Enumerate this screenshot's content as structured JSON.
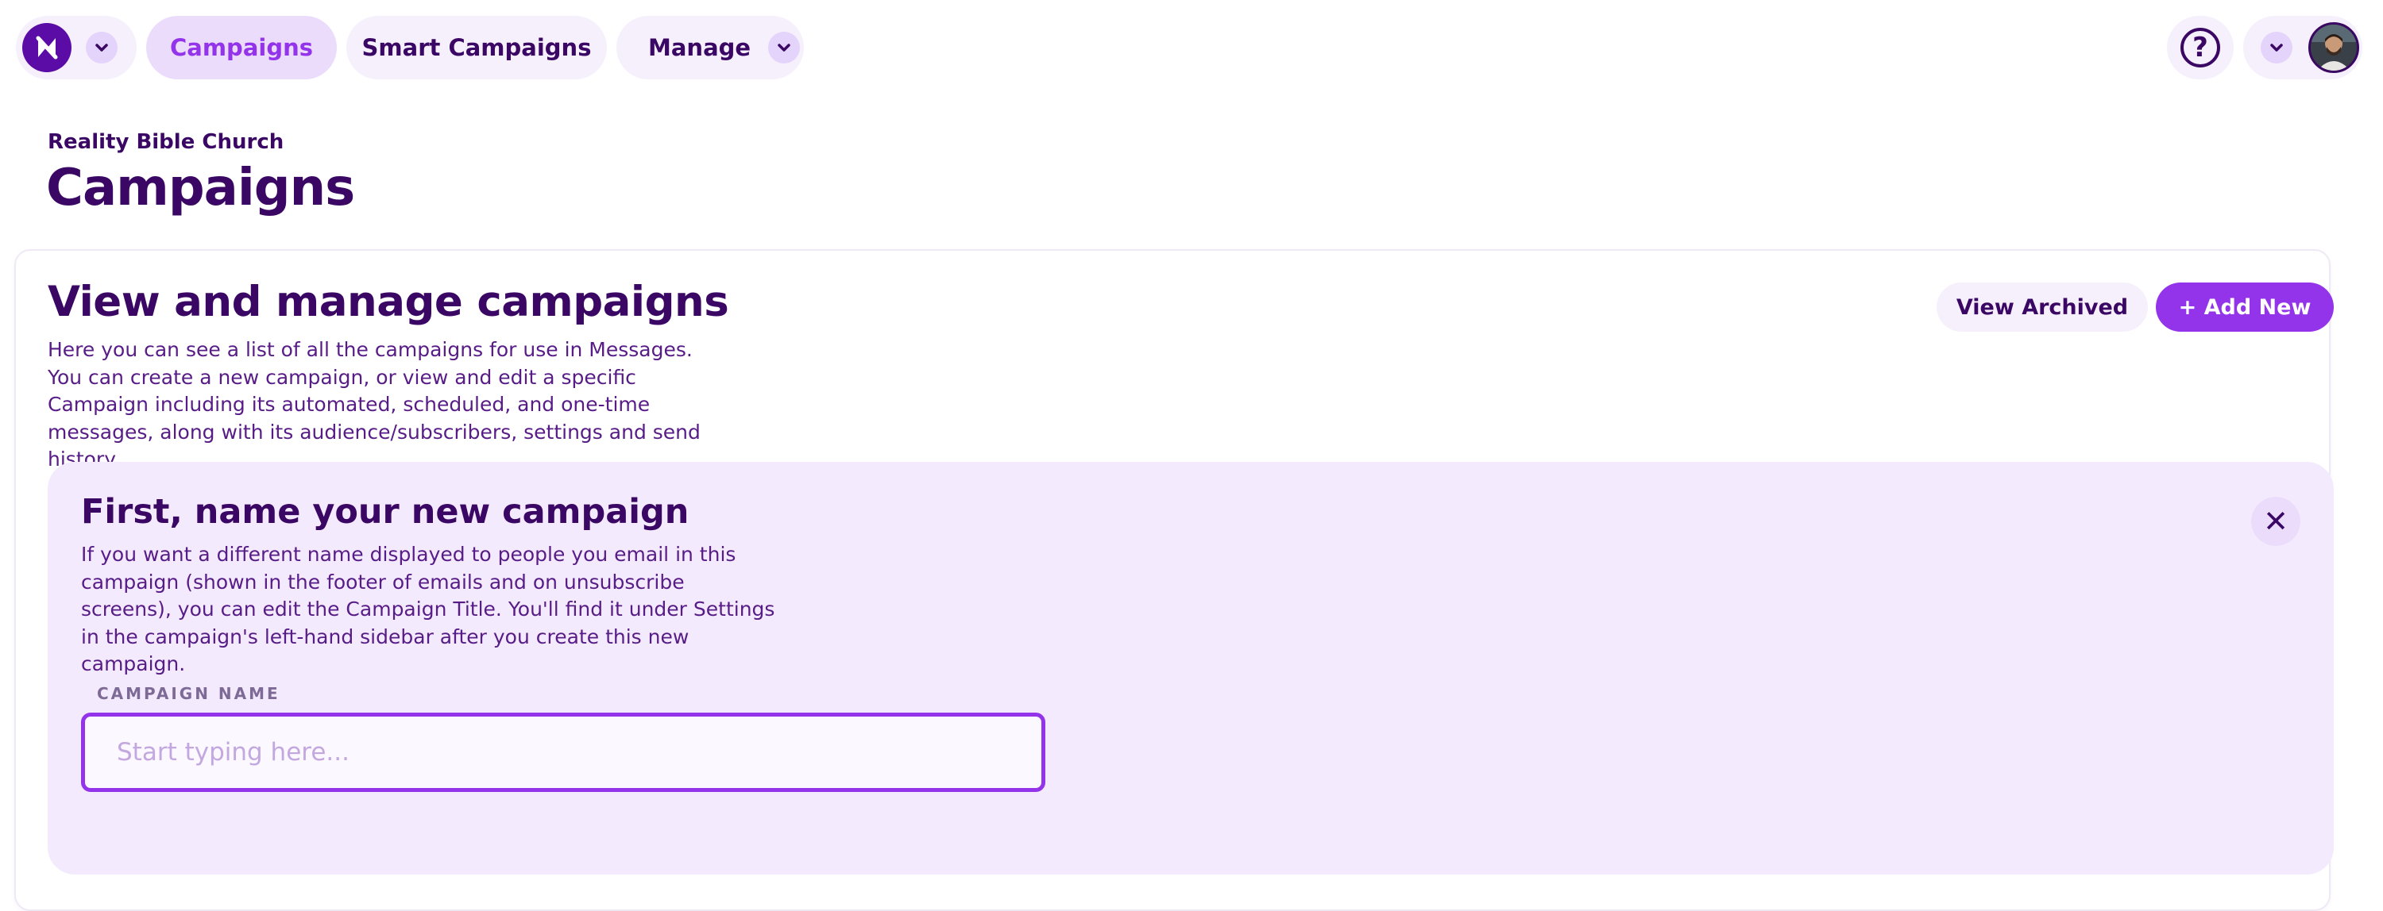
{
  "nav": {
    "brand_logo_letter": "N",
    "tabs": [
      {
        "label": "Campaigns",
        "active": true
      },
      {
        "label": "Smart Campaigns",
        "active": false
      },
      {
        "label": "Manage",
        "active": false
      }
    ],
    "help_symbol": "?"
  },
  "header": {
    "org_name": "Reality Bible Church",
    "title": "Campaigns"
  },
  "card": {
    "title": "View and manage campaigns",
    "description": "Here you can see a list of all the campaigns for use in Messages. You can create a new campaign, or view and edit a specific Campaign including its automated, scheduled, and one-time messages, along with its audience/subscribers, settings and send history.",
    "view_archived_label": "View Archived",
    "add_new_label": "+ Add New"
  },
  "new_campaign": {
    "title": "First, name your new campaign",
    "description": "If you want a different name displayed to people you email in this campaign (shown in the footer of emails and on unsubscribe screens), you can edit the Campaign Title. You'll find it under Settings in the campaign's left-hand sidebar after you create this new campaign.",
    "field_label": "CAMPAIGN NAME",
    "field_placeholder": "Start typing here...",
    "field_value": "",
    "close_symbol": "✕"
  },
  "colors": {
    "brand_dark": "#3b0764",
    "accent": "#9333ea",
    "pill_bg": "#f6f0fd",
    "panel_bg": "#f3ebfd"
  },
  "icons": [
    "brand-logo-icon",
    "chevron-down-icon",
    "help-icon",
    "avatar",
    "close-icon"
  ]
}
